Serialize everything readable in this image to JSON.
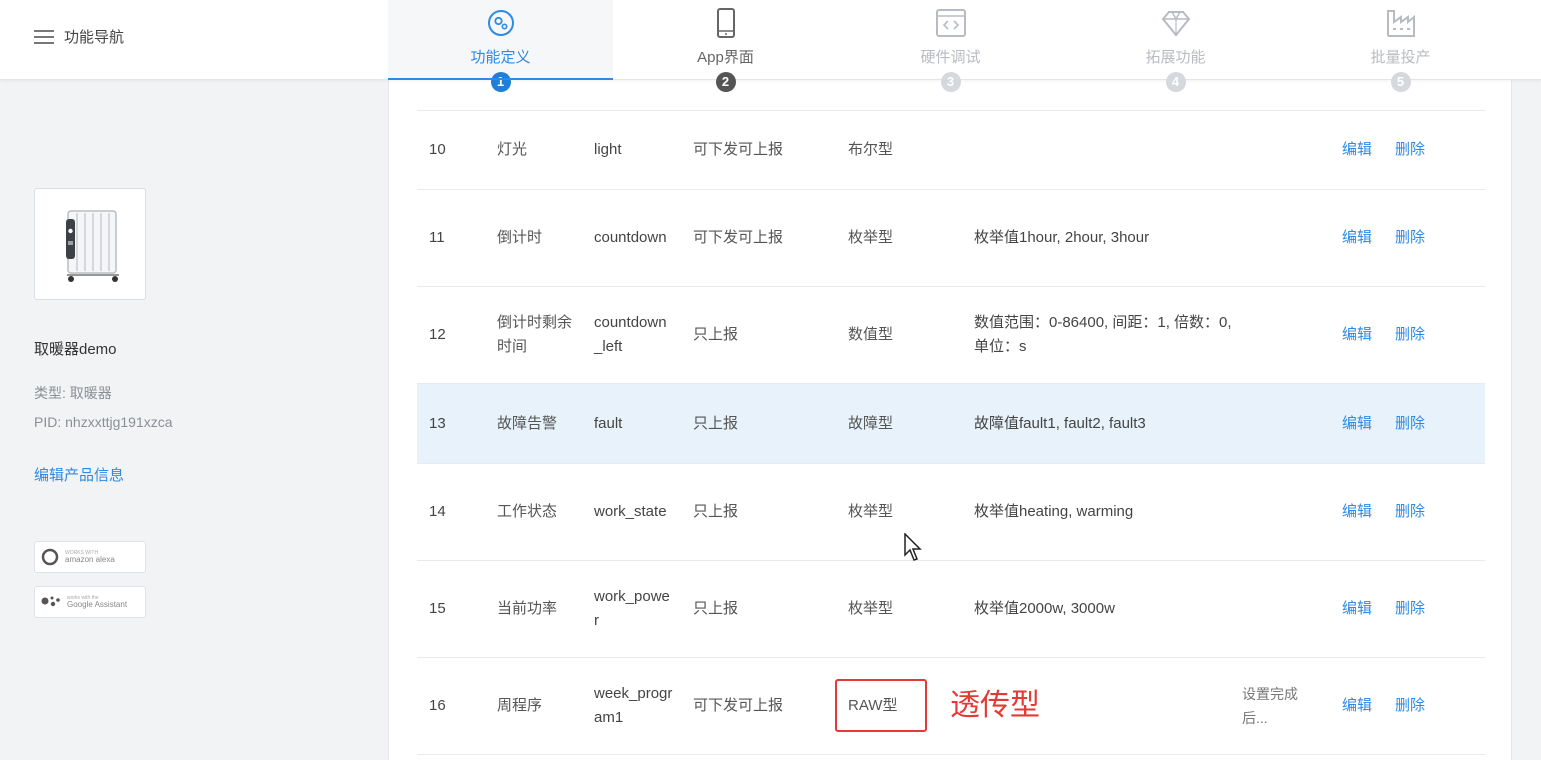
{
  "nav": {
    "label": "功能导航"
  },
  "steps": [
    {
      "label": "功能定义",
      "number": "1",
      "state": "active",
      "icon": "gear-circle-icon"
    },
    {
      "label": "App界面",
      "number": "2",
      "state": "done",
      "icon": "phone-icon"
    },
    {
      "label": "硬件调试",
      "number": "3",
      "state": "pending",
      "icon": "code-window-icon"
    },
    {
      "label": "拓展功能",
      "number": "4",
      "state": "pending",
      "icon": "diamond-icon"
    },
    {
      "label": "批量投产",
      "number": "5",
      "state": "pending",
      "icon": "factory-icon"
    }
  ],
  "product": {
    "name": "取暖器demo",
    "type": "类型: 取暖器",
    "pid": "PID: nhzxxttjg191xzca",
    "edit_link": "编辑产品信息",
    "badges": [
      {
        "small": "WORKS WITH",
        "label": "amazon alexa",
        "icon": "alexa-icon"
      },
      {
        "small": "works with the",
        "label": "Google Assistant",
        "icon": "google-assistant-icon"
      }
    ]
  },
  "table": {
    "rows": [
      {
        "id": "10",
        "name": "灯光",
        "code": "light",
        "mode": "可下发可上报",
        "type": "布尔型",
        "prop": "",
        "remark": "",
        "edit": "编辑",
        "del": "删除"
      },
      {
        "id": "11",
        "name": "倒计时",
        "code": "countdown",
        "mode": "可下发可上报",
        "type": "枚举型",
        "prop": "枚举值1hour, 2hour, 3hour",
        "remark": "",
        "edit": "编辑",
        "del": "删除"
      },
      {
        "id": "12",
        "name": "倒计时剩余时间",
        "code": "countdown_left",
        "mode": "只上报",
        "type": "数值型",
        "prop": "数值范围：0-86400, 间距：1, 倍数：0, 单位：s",
        "remark": "",
        "edit": "编辑",
        "del": "删除"
      },
      {
        "id": "13",
        "name": "故障告警",
        "code": "fault",
        "mode": "只上报",
        "type": "故障型",
        "prop": "故障值fault1, fault2, fault3",
        "remark": "",
        "edit": "编辑",
        "del": "删除"
      },
      {
        "id": "14",
        "name": "工作状态",
        "code": "work_state",
        "mode": "只上报",
        "type": "枚举型",
        "prop": "枚举值heating, warming",
        "remark": "",
        "edit": "编辑",
        "del": "删除"
      },
      {
        "id": "15",
        "name": "当前功率",
        "code": "work_power",
        "mode": "只上报",
        "type": "枚举型",
        "prop": "枚举值2000w, 3000w",
        "remark": "",
        "edit": "编辑",
        "del": "删除"
      },
      {
        "id": "16",
        "name": "周程序",
        "code": "week_program1",
        "mode": "可下发可上报",
        "type": "RAW型",
        "prop": "",
        "remark": "设置完成后...",
        "edit": "编辑",
        "del": "删除"
      }
    ]
  },
  "annotation": "透传型",
  "colors": {
    "accent": "#2d8ae6",
    "highlight_row": "#e7f2fb",
    "annotation": "#e53935"
  }
}
